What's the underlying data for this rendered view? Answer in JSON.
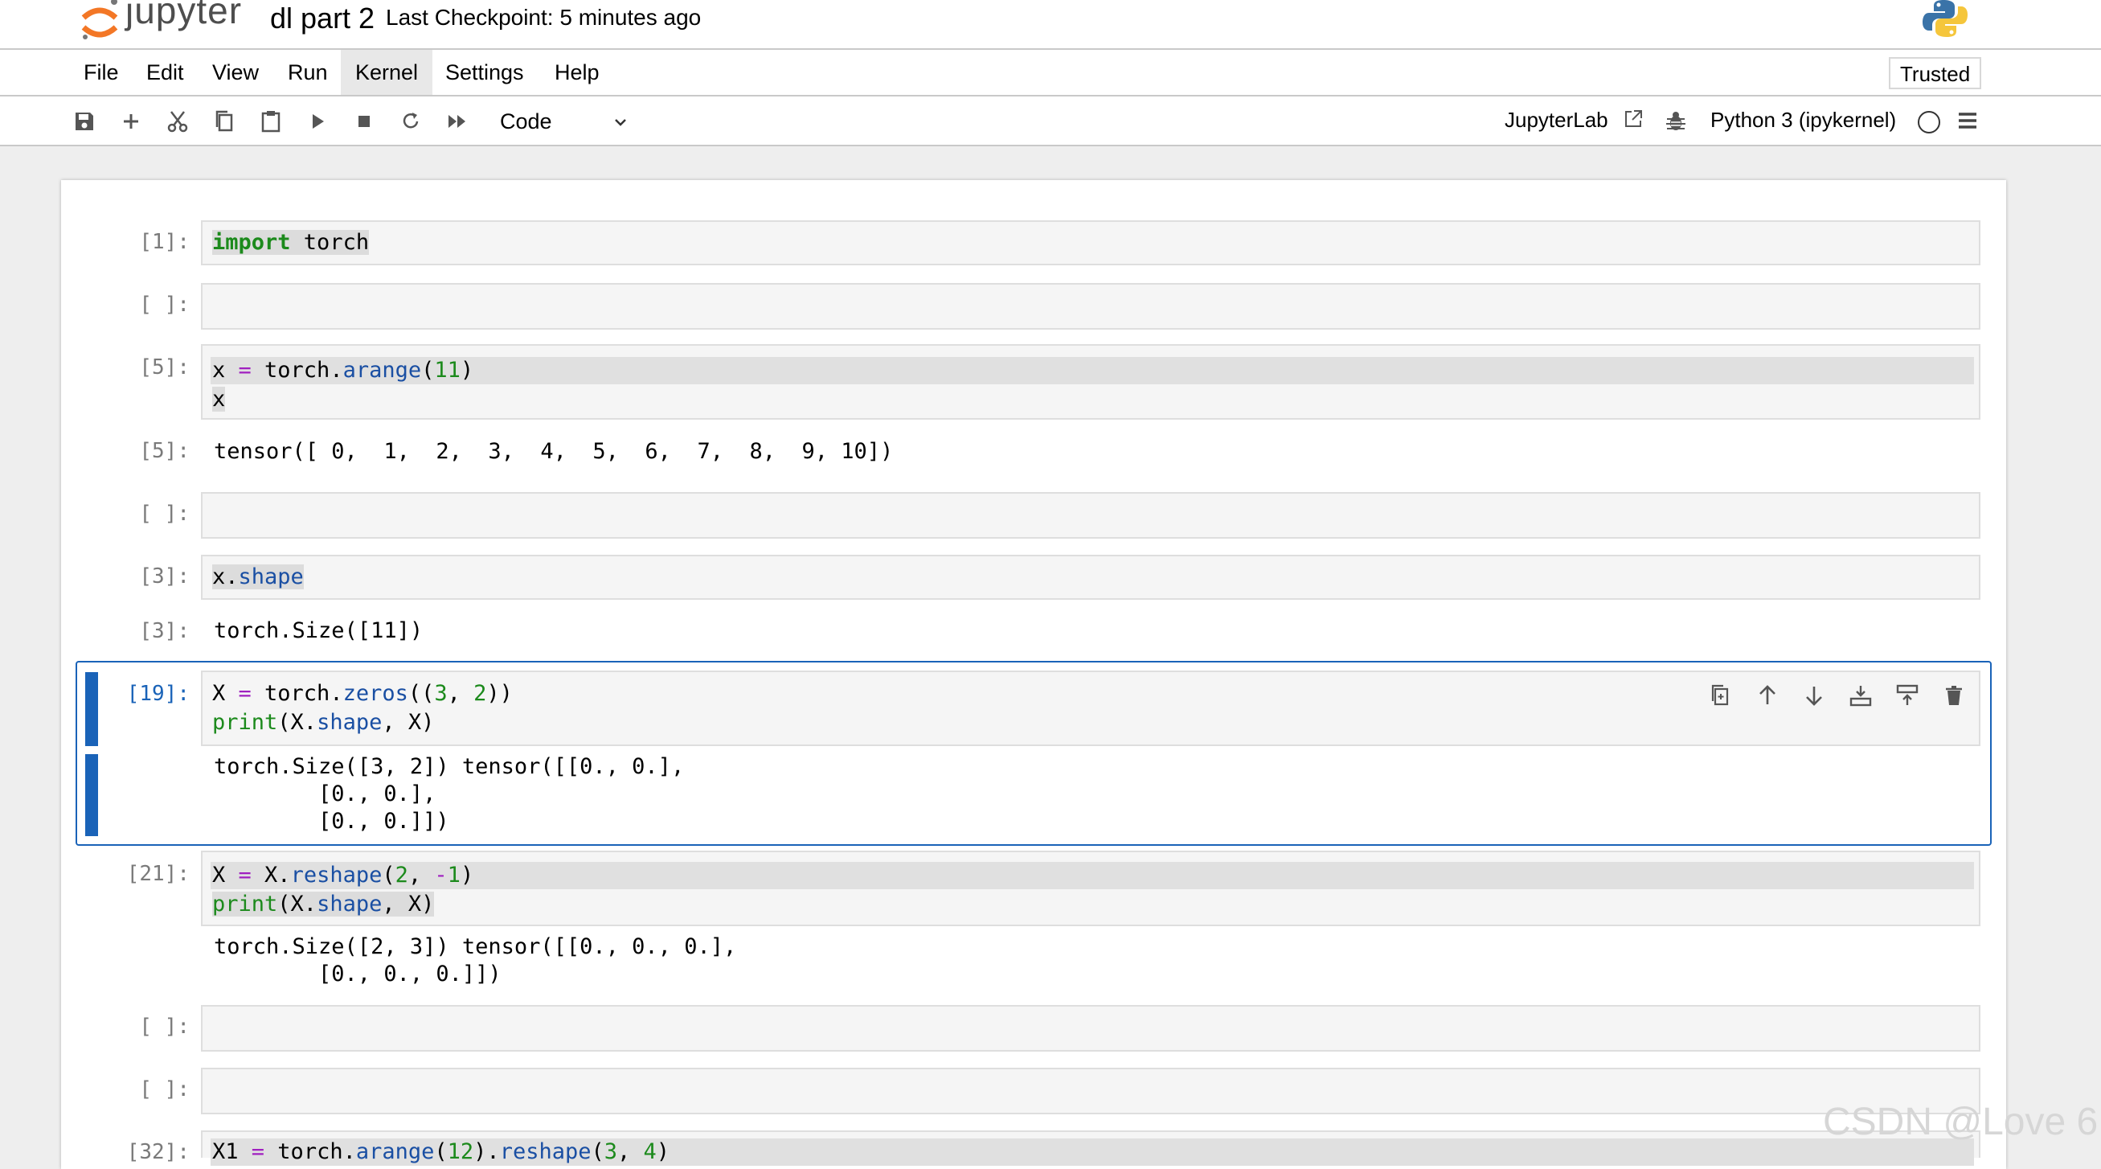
{
  "header": {
    "logo_text": "jupyter",
    "notebook_name": "dl part 2",
    "checkpoint": "Last Checkpoint: 5 minutes ago"
  },
  "menu": {
    "items": [
      "File",
      "Edit",
      "View",
      "Run",
      "Kernel",
      "Settings",
      "Help"
    ],
    "active": "Kernel",
    "trusted": "Trusted"
  },
  "toolbar": {
    "icons": [
      "save-icon",
      "add-cell-icon",
      "cut-icon",
      "copy-icon",
      "paste-icon",
      "run-icon",
      "stop-icon",
      "restart-icon",
      "run-all-icon"
    ],
    "cell_type": "Code",
    "jupyterlab_link": "JupyterLab",
    "kernel_name": "Python 3 (ipykernel)"
  },
  "cells": [
    {
      "prompt": "[1]:",
      "code": [
        "import torch"
      ]
    },
    {
      "prompt": "[ ]:",
      "code": []
    },
    {
      "prompt": "[5]:",
      "code": [
        "x = torch.arange(11)",
        "x"
      ],
      "out_prompt": "[5]:",
      "output": [
        "tensor([ 0,  1,  2,  3,  4,  5,  6,  7,  8,  9, 10])"
      ]
    },
    {
      "prompt": "[ ]:",
      "code": []
    },
    {
      "prompt": "[3]:",
      "code": [
        "x.shape"
      ],
      "out_prompt": "[3]:",
      "output": [
        "torch.Size([11])"
      ]
    },
    {
      "prompt": "[19]:",
      "code": [
        "X = torch.zeros((3, 2))",
        "print(X.shape, X)"
      ],
      "output": [
        "torch.Size([3, 2]) tensor([[0., 0.],",
        "        [0., 0.],",
        "        [0., 0.]])"
      ]
    },
    {
      "prompt": "[21]:",
      "code": [
        "X = X.reshape(2, -1)",
        "print(X.shape, X)"
      ],
      "output": [
        "torch.Size([2, 3]) tensor([[0., 0., 0.],",
        "        [0., 0., 0.]])"
      ]
    },
    {
      "prompt": "[ ]:",
      "code": []
    },
    {
      "prompt": "[ ]:",
      "code": []
    },
    {
      "prompt": "[32]:",
      "code": [
        "X1 = torch.arange(12).reshape(3, 4)"
      ]
    }
  ],
  "cell_toolbar": [
    "duplicate-icon",
    "move-up-icon",
    "move-down-icon",
    "insert-below-icon",
    "insert-above-icon",
    "delete-icon"
  ],
  "watermark": "CSDN @Love 6"
}
